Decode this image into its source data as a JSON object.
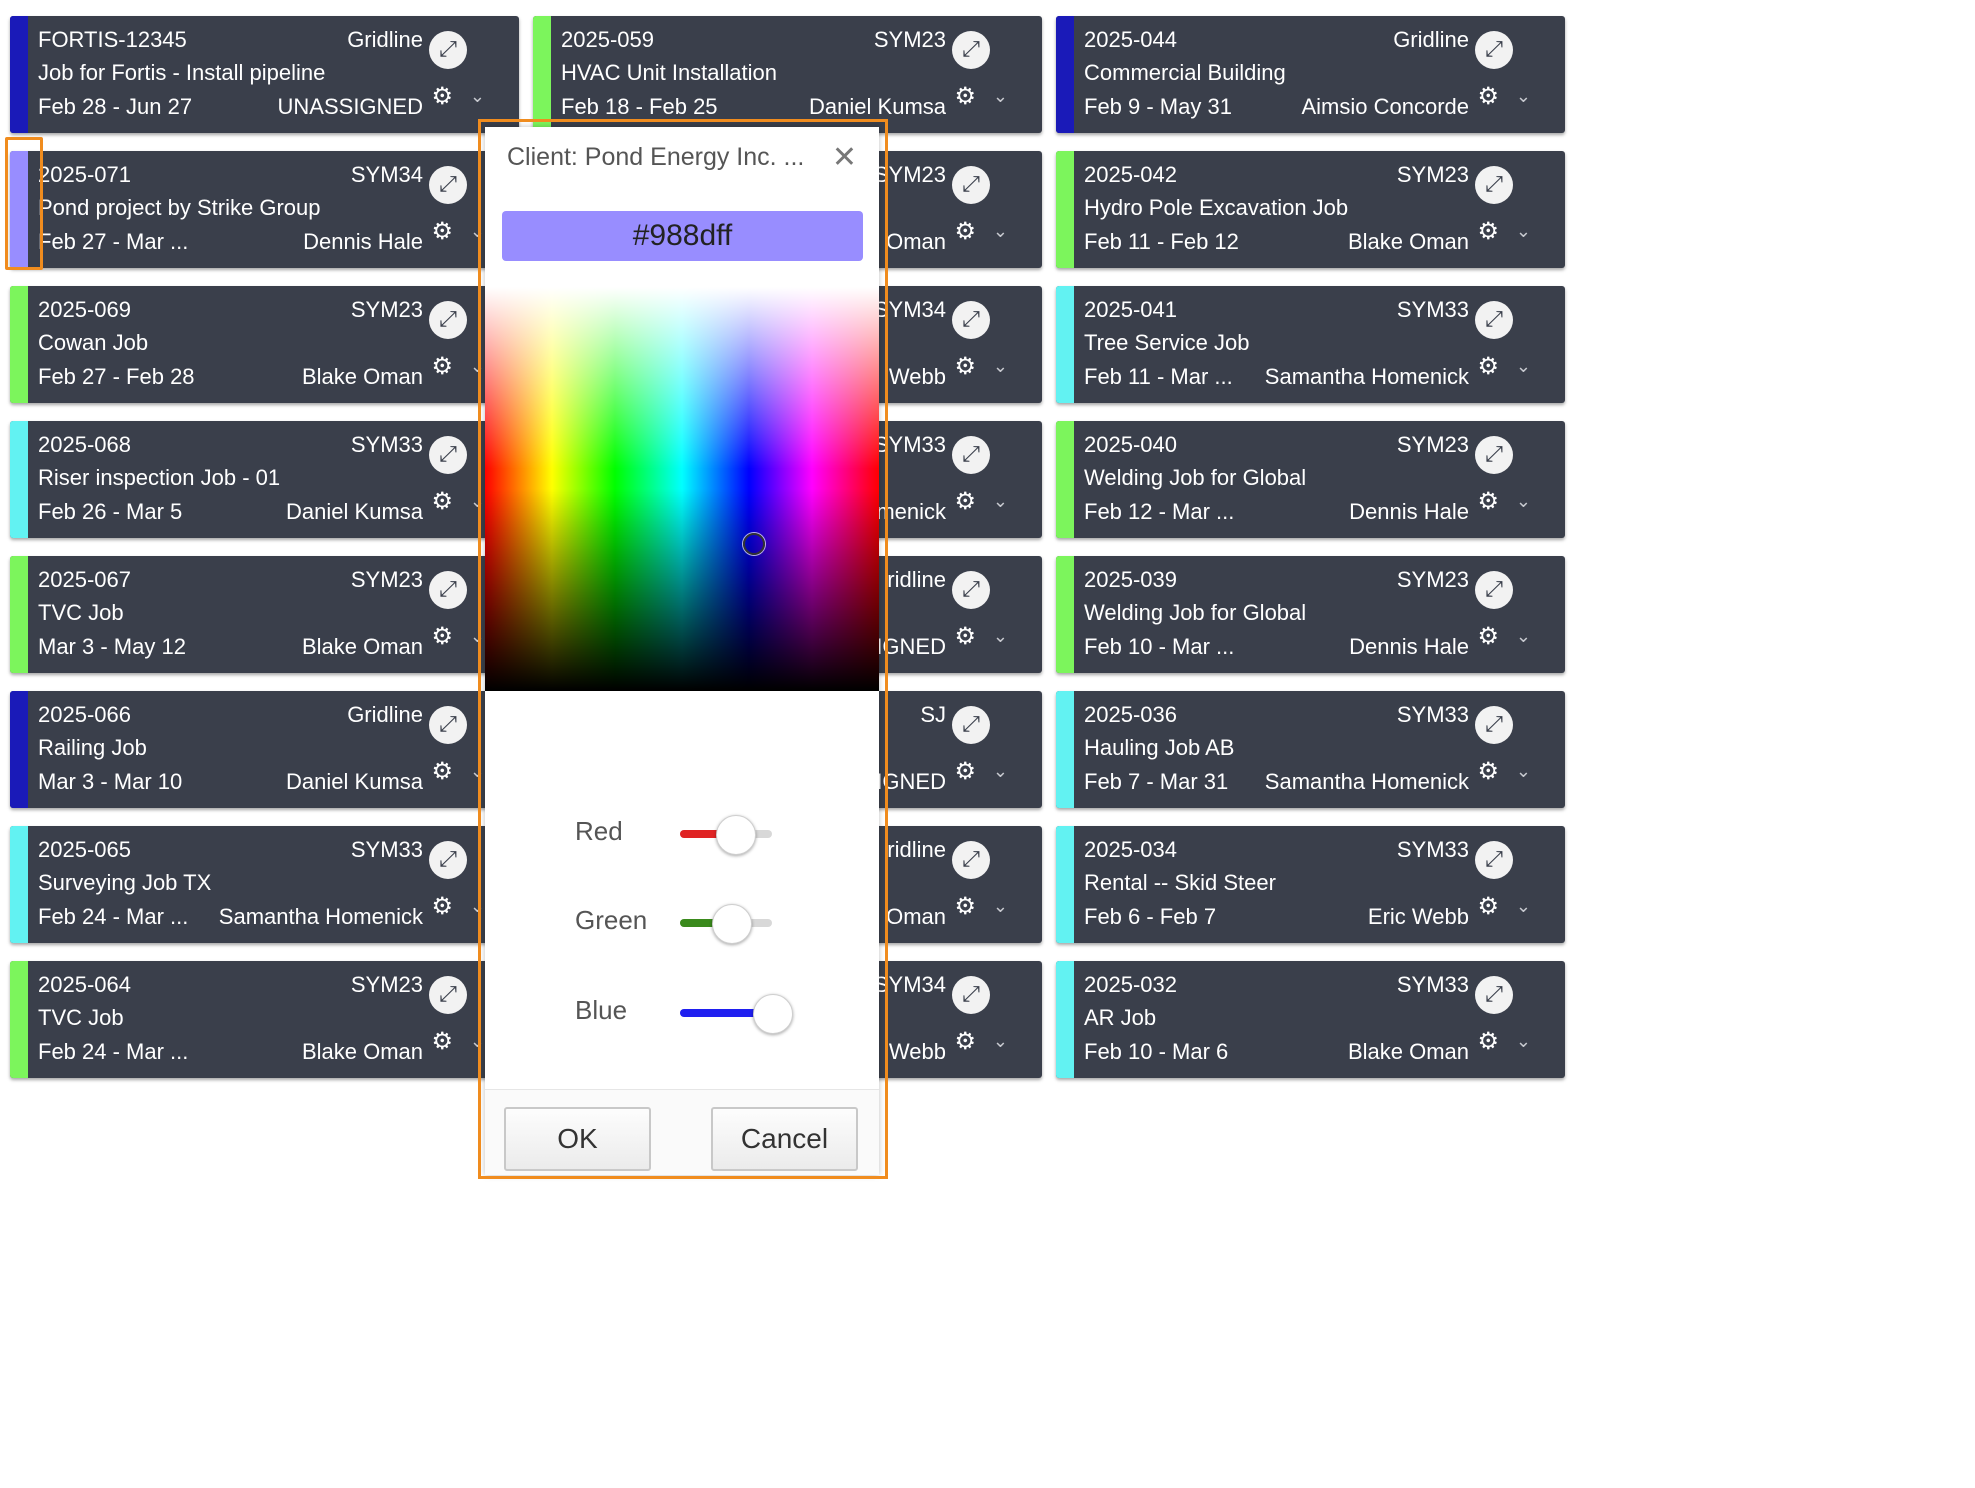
{
  "columns": [
    [
      {
        "id": "FORTIS-12345",
        "group": "Gridline",
        "title": "Job for Fortis - Install pipeline",
        "dates": "Feb 28 - Jun 27",
        "assignee": "UNASSIGNED",
        "color": "#1a1ab8"
      },
      {
        "id": "2025-071",
        "group": "SYM34",
        "title": "Pond project by Strike Group",
        "dates": "Feb 27 - Mar ...",
        "assignee": "Dennis Hale",
        "color": "#988dff"
      },
      {
        "id": "2025-069",
        "group": "SYM23",
        "title": "Cowan Job",
        "dates": "Feb 27 - Feb 28",
        "assignee": "Blake Oman",
        "color": "#7cf55c"
      },
      {
        "id": "2025-068",
        "group": "SYM33",
        "title": "Riser inspection Job - 01",
        "dates": "Feb 26 - Mar 5",
        "assignee": "Daniel Kumsa",
        "color": "#62f2f2"
      },
      {
        "id": "2025-067",
        "group": "SYM23",
        "title": "TVC Job",
        "dates": "Mar 3 - May 12",
        "assignee": "Blake Oman",
        "color": "#7cf55c"
      },
      {
        "id": "2025-066",
        "group": "Gridline",
        "title": "Railing Job",
        "dates": "Mar 3 - Mar 10",
        "assignee": "Daniel Kumsa",
        "color": "#1a1ab8"
      },
      {
        "id": "2025-065",
        "group": "SYM33",
        "title": "Surveying Job TX",
        "dates": "Feb 24 - Mar ...",
        "assignee": "Samantha Homenick",
        "color": "#62f2f2"
      },
      {
        "id": "2025-064",
        "group": "SYM23",
        "title": "TVC Job",
        "dates": "Feb 24 - Mar ...",
        "assignee": "Blake Oman",
        "color": "#7cf55c"
      }
    ],
    [
      {
        "id": "2025-059",
        "group": "SYM23",
        "title": "HVAC Unit Installation",
        "dates": "Feb 18 - Feb 25",
        "assignee": "Daniel Kumsa",
        "color": "#7cf55c"
      },
      {
        "id": "",
        "group": "SYM23",
        "title": "",
        "dates": "",
        "assignee": "Oman",
        "color": "#7cf55c"
      },
      {
        "id": "",
        "group": "SYM34",
        "title": "",
        "dates": "",
        "assignee": "Webb",
        "color": "#988dff"
      },
      {
        "id": "",
        "group": "SYM33",
        "title": "",
        "dates": "",
        "assignee": "menick",
        "color": "#62f2f2"
      },
      {
        "id": "",
        "group": "ridline",
        "title": "",
        "dates": "",
        "assignee": "IGNED",
        "color": "#1a1ab8"
      },
      {
        "id": "",
        "group": "SJ",
        "title": "",
        "dates": "",
        "assignee": "IGNED",
        "color": "#7cf55c"
      },
      {
        "id": "",
        "group": "ridline",
        "title": "",
        "dates": "",
        "assignee": "Oman",
        "color": "#1a1ab8"
      },
      {
        "id": "",
        "group": "SYM34",
        "title": "",
        "dates": "",
        "assignee": "Webb",
        "color": "#988dff"
      }
    ],
    [
      {
        "id": "2025-044",
        "group": "Gridline",
        "title": "Commercial Building",
        "dates": "Feb 9 - May 31",
        "assignee": "Aimsio Concorde",
        "color": "#1a1ab8"
      },
      {
        "id": "2025-042",
        "group": "SYM23",
        "title": "Hydro Pole Excavation Job",
        "dates": "Feb 11 - Feb 12",
        "assignee": "Blake Oman",
        "color": "#7cf55c"
      },
      {
        "id": "2025-041",
        "group": "SYM33",
        "title": "Tree Service Job",
        "dates": "Feb 11 - Mar ...",
        "assignee": "Samantha Homenick",
        "color": "#62f2f2"
      },
      {
        "id": "2025-040",
        "group": "SYM23",
        "title": "Welding Job for Global",
        "dates": "Feb 12 - Mar ...",
        "assignee": "Dennis Hale",
        "color": "#7cf55c"
      },
      {
        "id": "2025-039",
        "group": "SYM23",
        "title": "Welding Job for Global",
        "dates": "Feb 10 - Mar ...",
        "assignee": "Dennis Hale",
        "color": "#7cf55c"
      },
      {
        "id": "2025-036",
        "group": "SYM33",
        "title": "Hauling Job AB",
        "dates": "Feb 7 - Mar 31",
        "assignee": "Samantha Homenick",
        "color": "#62f2f2"
      },
      {
        "id": "2025-034",
        "group": "SYM33",
        "title": "Rental -- Skid Steer",
        "dates": "Feb 6 - Feb 7",
        "assignee": "Eric Webb",
        "color": "#62f2f2"
      },
      {
        "id": "2025-032",
        "group": "SYM33",
        "title": "AR Job",
        "dates": "Feb 10 - Mar 6",
        "assignee": "Blake Oman",
        "color": "#62f2f2"
      }
    ]
  ],
  "card_icons": {
    "expand": "expand-icon",
    "settings": "gear-icon",
    "menu": "chevron-down-icon"
  },
  "dialog": {
    "title": "Client: Pond Energy Inc. ...",
    "close_icon": "close-icon",
    "hex": "#988dff",
    "sliders": [
      {
        "label": "Red",
        "color": "#e02424",
        "level": 0.6
      },
      {
        "label": "Green",
        "color": "#3a8a1c",
        "level": 0.55
      },
      {
        "label": "Blue",
        "color": "#1f1ff0",
        "level": 1.0
      }
    ],
    "ok_label": "OK",
    "cancel_label": "Cancel"
  },
  "colors": {
    "card_bg": "#3a3f4b",
    "highlight": "#f08c1e",
    "selected_color": "#988dff"
  }
}
